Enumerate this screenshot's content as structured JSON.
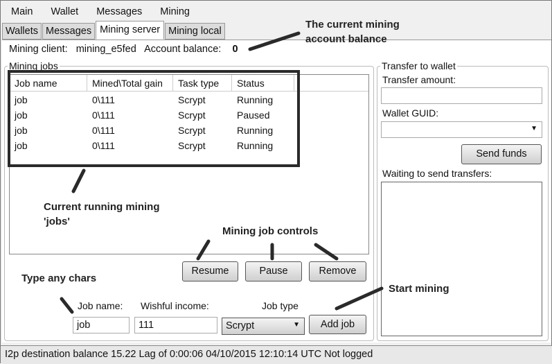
{
  "menu": [
    "Main",
    "Wallet",
    "Messages",
    "Mining"
  ],
  "tabs": [
    "Wallets",
    "Messages",
    "Mining server",
    "Mining local"
  ],
  "info": {
    "client_label": "Mining client:",
    "client_value": "mining_e5fed",
    "balance_label": "Account balance:",
    "balance_value": "0"
  },
  "jobs": {
    "legend": "Mining jobs",
    "columns": [
      "Job name",
      "Mined\\Total gain",
      "Task type",
      "Status"
    ],
    "rows": [
      [
        "job",
        "0\\111",
        "Scrypt",
        "Running"
      ],
      [
        "job",
        "0\\111",
        "Scrypt",
        "Paused"
      ],
      [
        "job",
        "0\\111",
        "Scrypt",
        "Running"
      ],
      [
        "job",
        "0\\111",
        "Scrypt",
        "Running"
      ]
    ]
  },
  "controls": {
    "resume": "Resume",
    "pause": "Pause",
    "remove": "Remove",
    "job_name_label": "Job name:",
    "job_name_value": "job",
    "income_label": "Wishful income:",
    "income_value": "111",
    "job_type_label": "Job type",
    "job_type_value": "Scrypt",
    "add_job": "Add job"
  },
  "transfer": {
    "legend": "Transfer to wallet",
    "amount_label": "Transfer amount:",
    "amount_value": "",
    "guid_label": "Wallet GUID:",
    "guid_value": "",
    "send": "Send funds",
    "waiting_label": "Waiting to send transfers:"
  },
  "status": "I2p destination balance 15.22  Lag of 0:00:06  04/10/2015 12:10:14 UTC  Not logged",
  "annotations": {
    "balance": "The current mining account balance",
    "jobs": "Current running mining 'jobs'",
    "controls": "Mining job controls",
    "type": "Type any chars",
    "start": "Start mining"
  }
}
